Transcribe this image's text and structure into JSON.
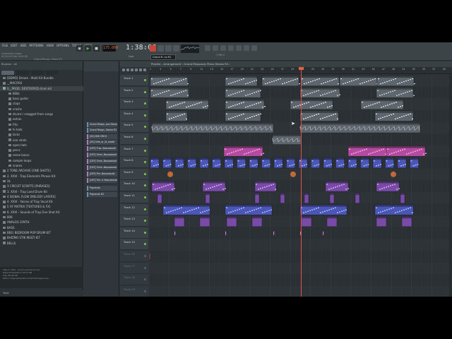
{
  "menu": [
    "FILE",
    "EDIT",
    "ADD",
    "PATTERNS",
    "VIEW",
    "OPTIONS",
    "TOOLS",
    "HELP"
  ],
  "hint": [
    "Overdrive mode",
    "47:01:00 Ver 9:00:00"
  ],
  "song_title": "Grand Rhaps. Piano R1",
  "tempo": "175.000",
  "time": "1:38:06",
  "time_sub": "B:S:T",
  "pattern_selector": "Grand R..no R1",
  "line_selector": "Line",
  "cpu": "3 MB 0",
  "browser": {
    "header": "Browser - All",
    "items": [
      {
        "label": "[DEMO] Dream - Multi Kit Bundle",
        "open": false
      },
      {
        "label": "__MACOSX",
        "open": false
      },
      {
        "label": "0__PROD. DESTROYED drum kit",
        "open": true
      },
      {
        "label": "808s",
        "open": false,
        "child": true
      },
      {
        "label": "bass guitar",
        "open": false,
        "child": true
      },
      {
        "label": "claps",
        "open": false,
        "child": true
      },
      {
        "label": "crashs",
        "open": false,
        "child": true
      },
      {
        "label": "drums i snagged from songs",
        "open": false,
        "child": true
      },
      {
        "label": "extras",
        "open": false,
        "child": true
      },
      {
        "label": "FXs",
        "open": false,
        "child": true
      },
      {
        "label": "hi hats",
        "open": false,
        "child": true
      },
      {
        "label": "kicks",
        "open": false,
        "child": true
      },
      {
        "label": "one shots",
        "open": false,
        "child": true
      },
      {
        "label": "open hats",
        "open": false,
        "child": true
      },
      {
        "label": "percs",
        "open": false,
        "child": true
      },
      {
        "label": "reese basss",
        "open": false,
        "child": true
      },
      {
        "label": "sample loops",
        "open": false,
        "child": true
      },
      {
        "label": "snares",
        "open": false,
        "child": true
      },
      {
        "label": "2 TONE ARCHIVE [ONE SHOTS]",
        "open": false
      },
      {
        "label": "2. XXVI - Trap Elements Phrase Kit",
        "open": false
      },
      {
        "label": "2k",
        "open": false
      },
      {
        "label": "3 CIRCUIT SCRIPTS [PHRASES]",
        "open": false
      },
      {
        "label": "3. XXVI - Trap Land Drum Kit",
        "open": false
      },
      {
        "label": "4 SIGNAL FLOW [MELODY LAYERS]",
        "open": false
      },
      {
        "label": "4. XXVI - Voices of Trap Vocal Kit",
        "open": false
      },
      {
        "label": "5 XY MATRIX [TEXTURES & FX]",
        "open": false
      },
      {
        "label": "6. XXVI - Sounds of Trap One Shot Kit",
        "open": false
      },
      {
        "label": "808",
        "open": false
      },
      {
        "label": "ANALOG SYNTH",
        "open": false
      },
      {
        "label": "BASS",
        "open": false
      },
      {
        "label": "BEE) BEDROOM POP DRUM KIT",
        "open": false
      },
      {
        "label": "BHIZMO STIK MULTI KIT",
        "open": false
      },
      {
        "label": "BELLS",
        "open": false
      }
    ],
    "info": [
      "Title    3. XXVI - Drum Land Drum Kit",
      "Date     6/19/2020 4:14:51 PM",
      "Size     46.86 KB",
      "Path     C:\\Users\\User\\Documents\\Image-Line\\..."
    ],
    "footer": "Tools"
  },
  "picker": [
    {
      "label": "Grand Rhaps..ono Stereo",
      "type": "pattern"
    },
    {
      "label": "Grand Rhaps..Stereo R2",
      "type": "pattern"
    },
    {
      "label": "[XX] 808 ORCH",
      "type": "audio"
    },
    {
      "label": "[XX] hide_or_lit_mobtr",
      "type": "audio"
    },
    {
      "label": "[DEF] Trap..Boxcadoubl",
      "type": "audio"
    },
    {
      "label": "[DEF] Shim..Boxcadoubl",
      "type": "audio"
    },
    {
      "label": "[DEF] Shim..Boxcadoubl",
      "type": "audio"
    },
    {
      "label": "[DEF] Shim..Boxcadoubl",
      "type": "audio"
    },
    {
      "label": "[DEF] Pre..Boxcadoubl",
      "type": "audio"
    },
    {
      "label": "[DEF] Pre..Ic Boxcadoubl",
      "type": "audio"
    },
    {
      "label": "Pigments",
      "type": "pattern"
    },
    {
      "label": "Pigments R2",
      "type": "pattern"
    }
  ],
  "playlist": {
    "title": "Playlist - Arrangement › Grand Rhapsody Piano Stereo R2 ›",
    "bar_ticks": [
      "1",
      "3",
      "5",
      "7",
      "9",
      "11",
      "13",
      "15",
      "17",
      "19",
      "21",
      "23",
      "25",
      "27",
      "29",
      "31",
      "33",
      "35",
      "37",
      "39",
      "41",
      "43",
      "45",
      "47",
      "49",
      "51",
      "53",
      "55",
      "57",
      "59"
    ],
    "tracks": [
      {
        "label": "Track 1",
        "dim": false
      },
      {
        "label": "Track 2",
        "dim": false
      },
      {
        "label": "Track 3",
        "dim": false
      },
      {
        "label": "Track 4",
        "dim": false
      },
      {
        "label": "Track 5",
        "dim": false
      },
      {
        "label": "Track 6",
        "dim": false
      },
      {
        "label": "Track 7",
        "dim": false
      },
      {
        "label": "Track 8",
        "dim": false
      },
      {
        "label": "Track 9",
        "dim": false
      },
      {
        "label": "Track 10",
        "dim": false
      },
      {
        "label": "Track 11",
        "dim": false
      },
      {
        "label": "Track 12",
        "dim": false
      },
      {
        "label": "Track 13",
        "dim": false
      },
      {
        "label": "Track 14",
        "dim": false
      },
      {
        "label": "Track 15",
        "dim": false
      },
      {
        "label": "Track 16",
        "dim": true
      },
      {
        "label": "Track 17",
        "dim": true
      },
      {
        "label": "Track 18",
        "dim": true
      },
      {
        "label": "Track 19",
        "dim": true
      }
    ]
  },
  "colors": {
    "clip_gray": "#5d666c",
    "clip_blue": "#4a56b8",
    "clip_purple": "#7a4aa8",
    "clip_pink": "#b64aa0",
    "clip_orange": "#c06a3a",
    "playhead": "#e05050"
  }
}
